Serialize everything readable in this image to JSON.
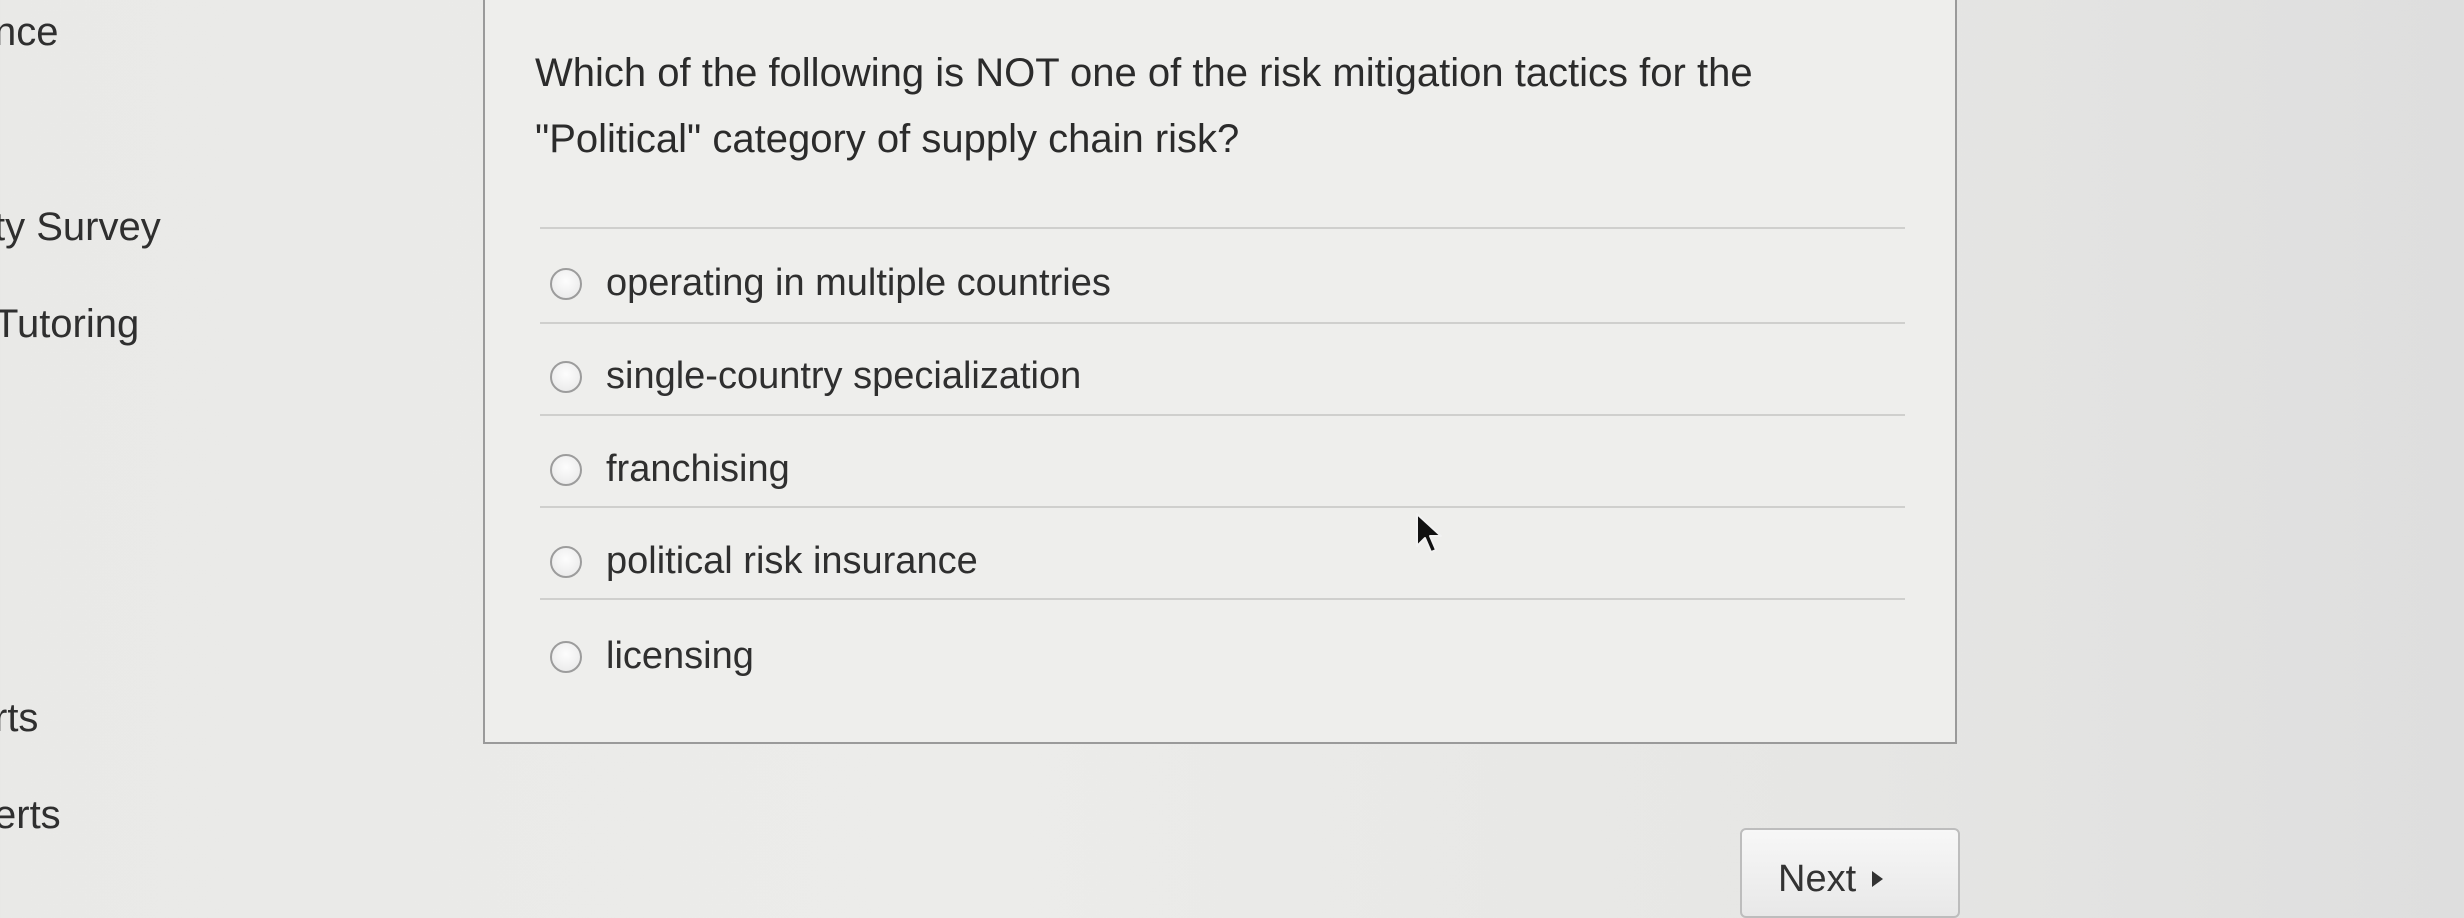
{
  "sidebar": {
    "items": [
      {
        "label": "nce"
      },
      {
        "label": "ty Survey"
      },
      {
        "label": "Tutoring"
      },
      {
        "label": "rts"
      },
      {
        "label": "erts"
      }
    ]
  },
  "question": {
    "text": "Which of the following is NOT one of the risk mitigation tactics for the \"Political\" category of supply chain risk?",
    "options": [
      {
        "label": "operating in multiple countries"
      },
      {
        "label": "single-country specialization"
      },
      {
        "label": "franchising"
      },
      {
        "label": "political risk insurance"
      },
      {
        "label": "licensing"
      }
    ]
  },
  "navigation": {
    "next_label": "Next"
  }
}
